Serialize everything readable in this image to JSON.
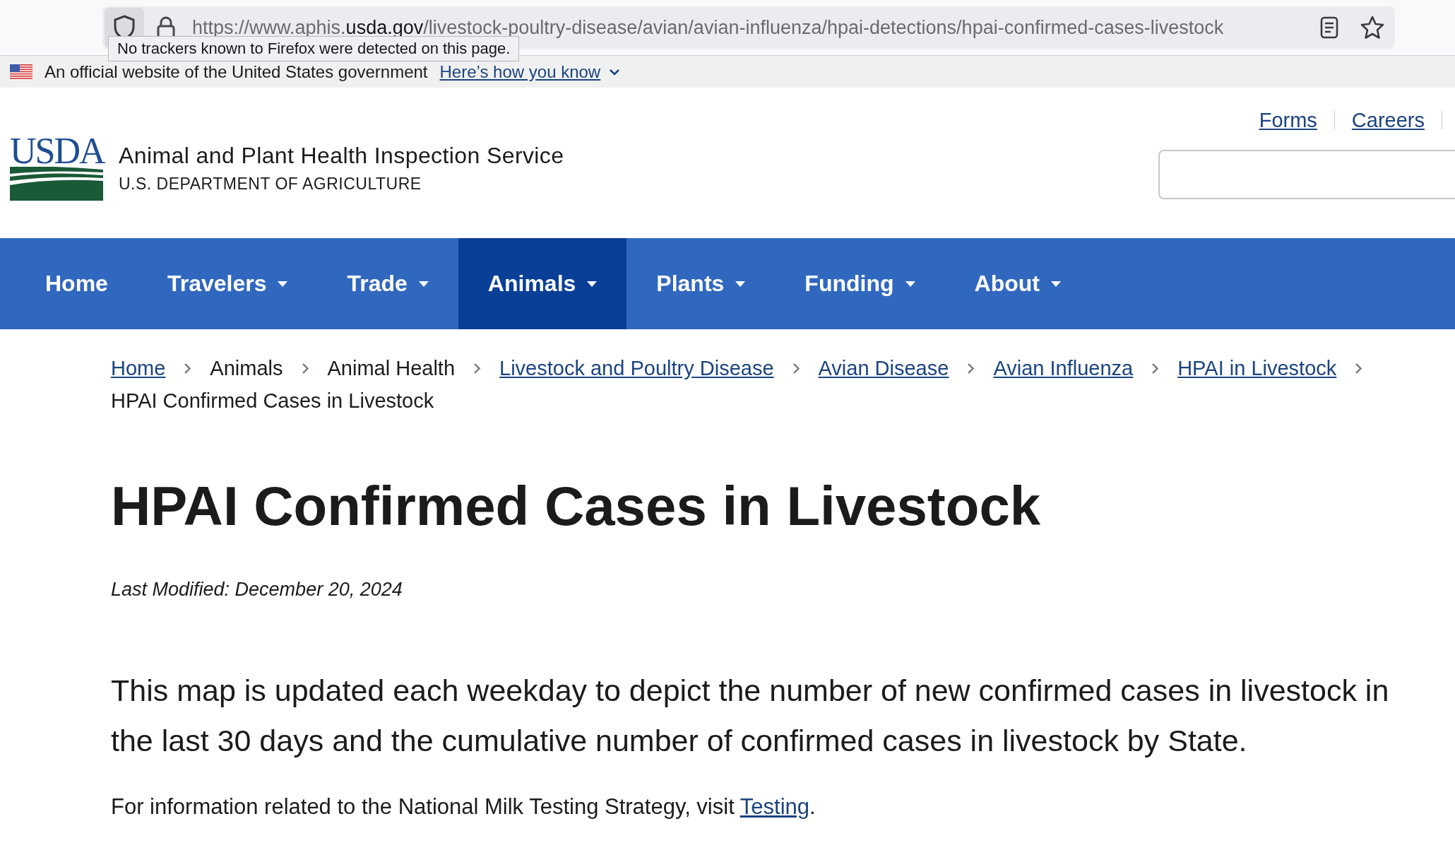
{
  "browser": {
    "url": {
      "prefix": "https://www.aphis.",
      "domain": "usda.gov",
      "path": "/livestock-poultry-disease/avian/avian-influenza/hpai-detections/hpai-confirmed-cases-livestock"
    },
    "tooltip": "No trackers known to Firefox were detected on this page."
  },
  "gov_banner": {
    "text": "An official website of the United States government",
    "link": "Here’s how you know"
  },
  "header": {
    "logo_text": "USDA",
    "agency": "Animal and Plant Health Inspection Service",
    "department": "U.S. DEPARTMENT OF AGRICULTURE",
    "links": [
      "Forms",
      "Careers"
    ]
  },
  "nav": [
    {
      "label": "Home",
      "dropdown": false,
      "selected": false
    },
    {
      "label": "Travelers",
      "dropdown": true,
      "selected": false
    },
    {
      "label": "Trade",
      "dropdown": true,
      "selected": false
    },
    {
      "label": "Animals",
      "dropdown": true,
      "selected": true
    },
    {
      "label": "Plants",
      "dropdown": true,
      "selected": false
    },
    {
      "label": "Funding",
      "dropdown": true,
      "selected": false
    },
    {
      "label": "About",
      "dropdown": true,
      "selected": false
    }
  ],
  "breadcrumb": [
    {
      "label": "Home",
      "link": true
    },
    {
      "label": "Animals",
      "link": false
    },
    {
      "label": "Animal Health",
      "link": false
    },
    {
      "label": "Livestock and Poultry Disease",
      "link": true
    },
    {
      "label": "Avian Disease",
      "link": true
    },
    {
      "label": "Avian Influenza",
      "link": true
    },
    {
      "label": "HPAI in Livestock",
      "link": true
    },
    {
      "label": "HPAI Confirmed Cases in Livestock",
      "link": false
    }
  ],
  "title": "HPAI Confirmed Cases in Livestock",
  "last_modified": "Last Modified: December 20, 2024",
  "intro": "This map is updated each weekday to depict the number of new confirmed cases in livestock in the last 30 days and the cumulative number of confirmed cases in livestock by State.",
  "testing_note": {
    "before": "For information related to the National Milk Testing Strategy, visit ",
    "link": "Testing",
    "after": "."
  }
}
